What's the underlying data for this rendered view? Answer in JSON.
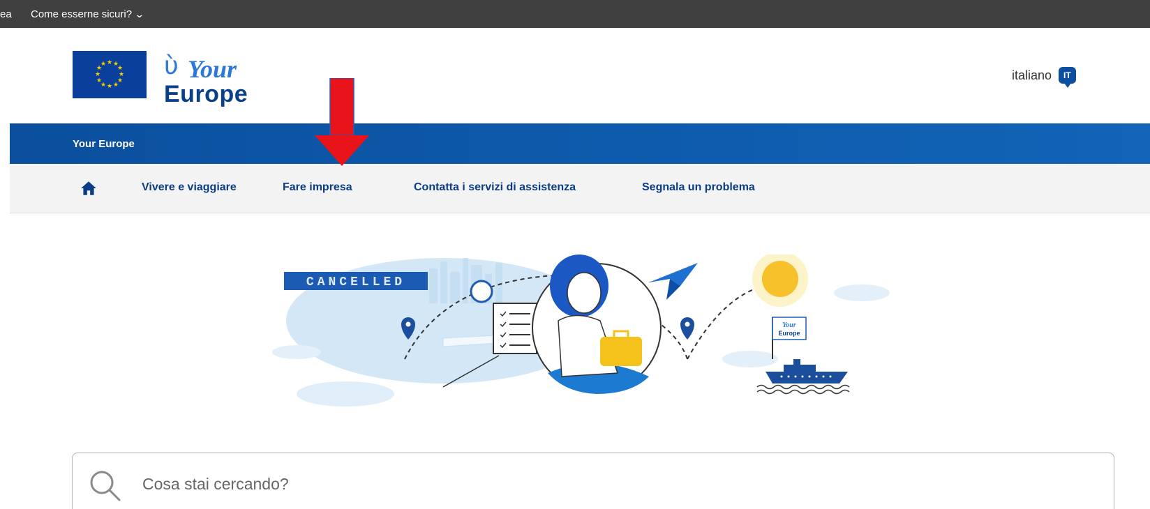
{
  "topbar": {
    "text_fragment": "ea",
    "secure_link": "Come esserne sicuri?",
    "chevron_icon": "chevron-down-icon"
  },
  "header": {
    "logo_line1": "Your",
    "logo_line2": "Europe",
    "language_label": "italiano",
    "language_code": "IT",
    "language_icon": "speech-bubble-icon"
  },
  "site_bar": {
    "title": "Your Europe"
  },
  "nav": {
    "home_icon": "home-icon",
    "items": [
      {
        "label": "Vivere e viaggiare"
      },
      {
        "label": "Fare impresa"
      },
      {
        "label": "Contatta i servizi di assistenza"
      },
      {
        "label": "Segnala un problema"
      }
    ]
  },
  "hero": {
    "board_text": "CANCELLED",
    "flag_text_1": "Your",
    "flag_text_2": "Europe"
  },
  "search": {
    "placeholder": "Cosa stai cercando?",
    "icon": "search-icon"
  },
  "colors": {
    "topbar": "#404040",
    "brand_blue": "#0b4f9e",
    "nav_text": "#0b3d85",
    "annotation_arrow": "#e8141a"
  }
}
